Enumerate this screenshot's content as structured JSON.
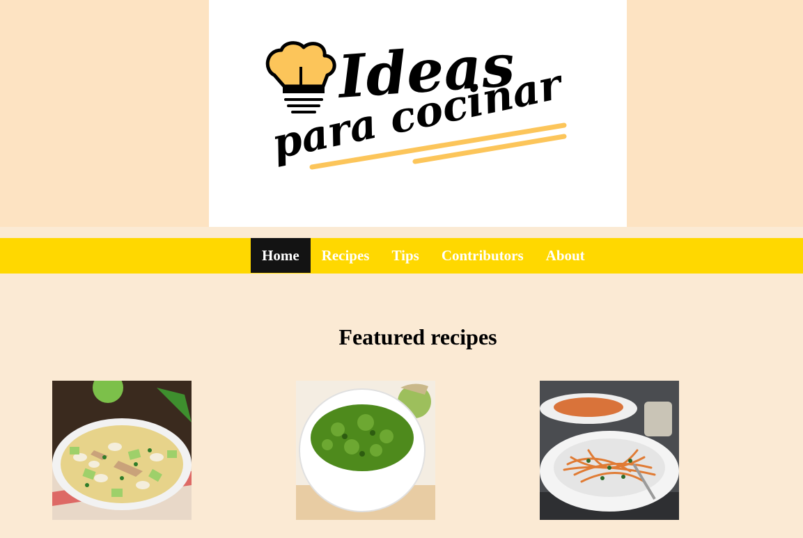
{
  "logo": {
    "line1": "Ideas",
    "line2": "para cocinar",
    "accent_color": "#fcc55a"
  },
  "nav": {
    "items": [
      {
        "label": "Home",
        "active": true
      },
      {
        "label": "Recipes",
        "active": false
      },
      {
        "label": "Tips",
        "active": false
      },
      {
        "label": "Contributors",
        "active": false
      },
      {
        "label": "About",
        "active": false
      }
    ]
  },
  "featured": {
    "title": "Featured recipes",
    "recipes": [
      {
        "image": "chicken-white-bean-avocado-soup"
      },
      {
        "image": "green-tomatillo-salsa-bowl"
      },
      {
        "image": "carrot-noodle-salad-plate"
      }
    ]
  },
  "colors": {
    "header_bg": "#fde3c2",
    "page_bg": "#fbead4",
    "nav_bg": "#ffd800",
    "nav_active_bg": "#131313"
  }
}
